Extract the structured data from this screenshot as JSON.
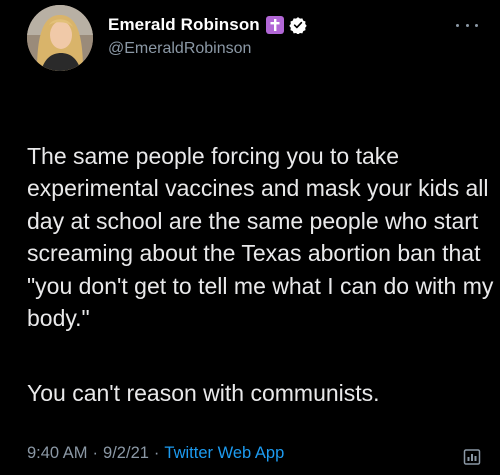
{
  "author": {
    "display_name": "Emerald Robinson",
    "handle": "@EmeraldRobinson",
    "badge_icon": "cross-icon",
    "verified_icon": "verified-checkmark-icon"
  },
  "tweet": {
    "paragraphs": [
      "The same people forcing you to take experimental vaccines and mask your kids all day at school are the same people who start screaming about the Texas abortion ban that \"you don't get to tell me what I can do with my body.\"",
      "You can't reason with communists."
    ]
  },
  "meta": {
    "time": "9:40 AM",
    "separator": "·",
    "date": "9/2/21",
    "source": "Twitter Web App"
  },
  "colors": {
    "background": "#000000",
    "text": "#e9e9ea",
    "muted": "#8b98a5",
    "link": "#1d9bf0",
    "badge": "#b267d6"
  }
}
